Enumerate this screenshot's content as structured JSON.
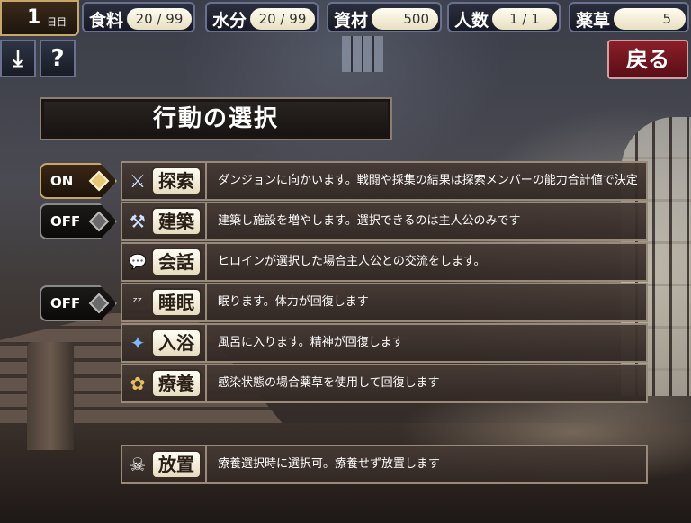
{
  "hud": {
    "day": {
      "number": "1",
      "unit": "日目"
    },
    "food": {
      "label": "食料",
      "value": "20 / 99"
    },
    "water": {
      "label": "水分",
      "value": "20 / 99"
    },
    "materials": {
      "label": "資材",
      "value": "500"
    },
    "people": {
      "label": "人数",
      "value": "1 / 1"
    },
    "herbs": {
      "label": "薬草",
      "value": "5"
    }
  },
  "buttons": {
    "save_icon": "⤓",
    "help": "?",
    "back": "戻る"
  },
  "title": "行動の選択",
  "toggles": {
    "explore": "ON",
    "build": "OFF",
    "sleep": "OFF"
  },
  "actions": [
    {
      "icon": "sword-icon",
      "glyph": "⚔",
      "label": "探索",
      "desc": "ダンジョンに向かいます。戦闘や採集の結果は探索メンバーの能力合計値で決定"
    },
    {
      "icon": "hammer-icon",
      "glyph": "⚒",
      "label": "建築",
      "desc": "建築し施設を増やします。選択できるのは主人公のみです"
    },
    {
      "icon": "chat-icon",
      "glyph": "💬",
      "label": "会話",
      "desc": "ヒロインが選択した場合主人公との交流をします。"
    },
    {
      "icon": "sleep-icon",
      "glyph": "ᶻᶻ",
      "label": "睡眠",
      "desc": "眠ります。体力が回復します"
    },
    {
      "icon": "bath-icon",
      "glyph": "✦",
      "label": "入浴",
      "desc": "風呂に入ります。精神が回復します"
    },
    {
      "icon": "herb-icon",
      "glyph": "✿",
      "label": "療養",
      "desc": "感染状態の場合薬草を使用して回復します"
    }
  ],
  "idle": {
    "icon": "skull-icon",
    "glyph": "☠",
    "label": "放置",
    "desc": "療養選択時に選択可。療養せず放置します"
  }
}
